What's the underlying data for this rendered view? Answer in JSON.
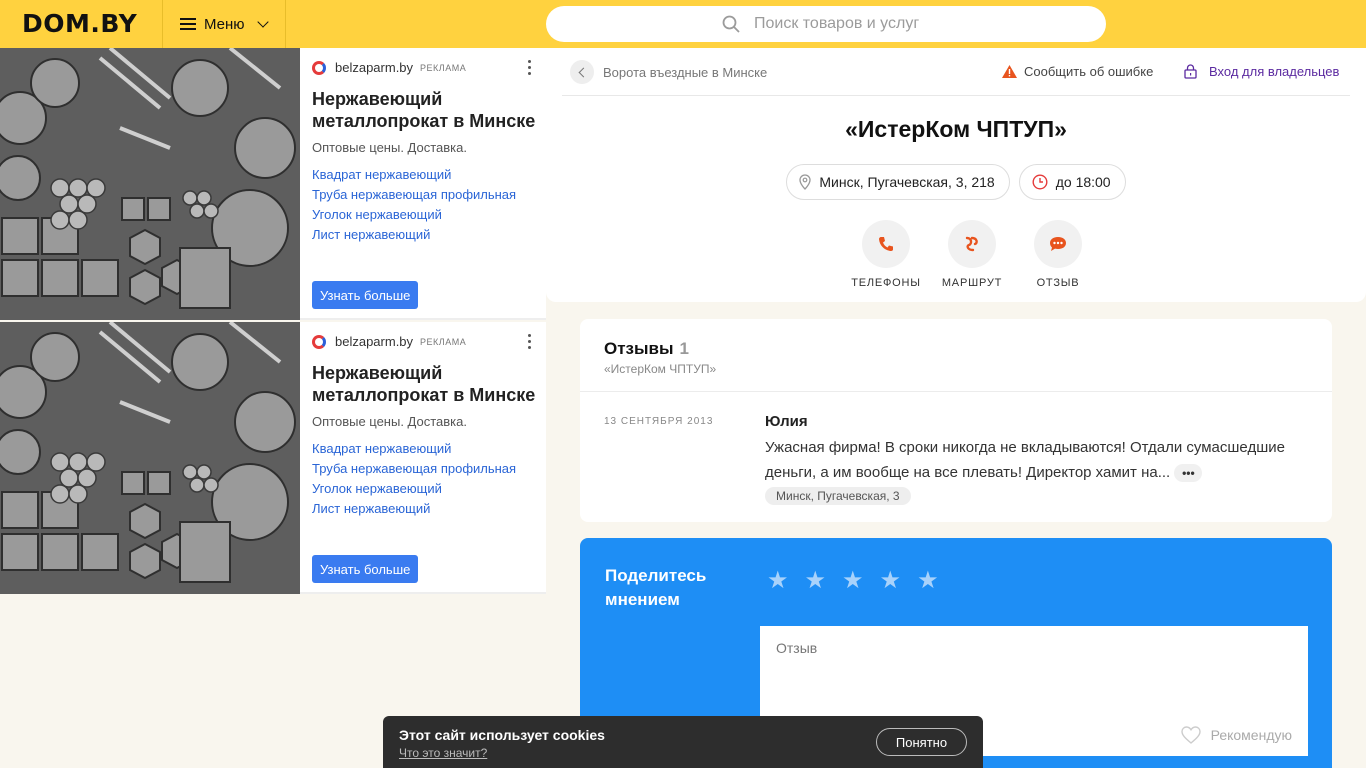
{
  "header": {
    "logo": "DOM.BY",
    "menu_label": "Меню",
    "search_placeholder": "Поиск товаров и услуг"
  },
  "ads": [
    {
      "source": "belzaparm.by",
      "tag": "РЕКЛАМА",
      "title": "Нержавеющий металлопрокат в Минске",
      "description": "Оптовые цены. Доставка.",
      "links": [
        "Квадрат нержавеющий",
        "Труба нержавеющая профильная",
        "Уголок нержавеющий",
        "Лист нержавеющий"
      ],
      "button": "Узнать больше"
    },
    {
      "source": "belzaparm.by",
      "tag": "РЕКЛАМА",
      "title": "Нержавеющий металлопрокат в Минске",
      "description": "Оптовые цены. Доставка.",
      "links": [
        "Квадрат нержавеющий",
        "Труба нержавеющая профильная",
        "Уголок нержавеющий",
        "Лист нержавеющий"
      ],
      "button": "Узнать больше"
    }
  ],
  "card": {
    "breadcrumb": "Ворота въездные в Минске",
    "report_label": "Сообщить об ошибке",
    "owners_label": "Вход для владельцев",
    "company_name": "«ИстерКом ЧПТУП»",
    "address": "Минск, Пугачевская, 3, 218",
    "hours": "до 18:00",
    "actions": [
      {
        "label": "ТЕЛЕФОНЫ",
        "icon": "phone-icon"
      },
      {
        "label": "МАРШРУТ",
        "icon": "route-icon"
      },
      {
        "label": "ОТЗЫВ",
        "icon": "comment-icon"
      }
    ]
  },
  "reviews": {
    "heading": "Отзывы",
    "count": "1",
    "subtitle": "«ИстерКом ЧПТУП»",
    "items": [
      {
        "date": "13 СЕНТЯБРЯ 2013",
        "author": "Юлия",
        "text": "Ужасная фирма! В сроки никогда не вкладываются! Отдали сумасшедшие деньги, а им вообще на все плевать! Директор хамит на...",
        "more": "•••",
        "address": "Минск, Пугачевская, 3"
      }
    ]
  },
  "share": {
    "title": "Поделитесь мнением",
    "review_placeholder": "Отзыв",
    "recommend_label": "Рекомендую",
    "star_color": "#a8d2fb"
  },
  "cookie": {
    "title": "Этот сайт использует cookies",
    "link": "Что это значит?",
    "button": "Понятно"
  },
  "colors": {
    "header_bg": "#ffd23f",
    "share_bg": "#1e8ef5",
    "accent_orange": "#e8541e",
    "link_blue": "#2a65d6",
    "owners_purple": "#5b2aa0"
  }
}
